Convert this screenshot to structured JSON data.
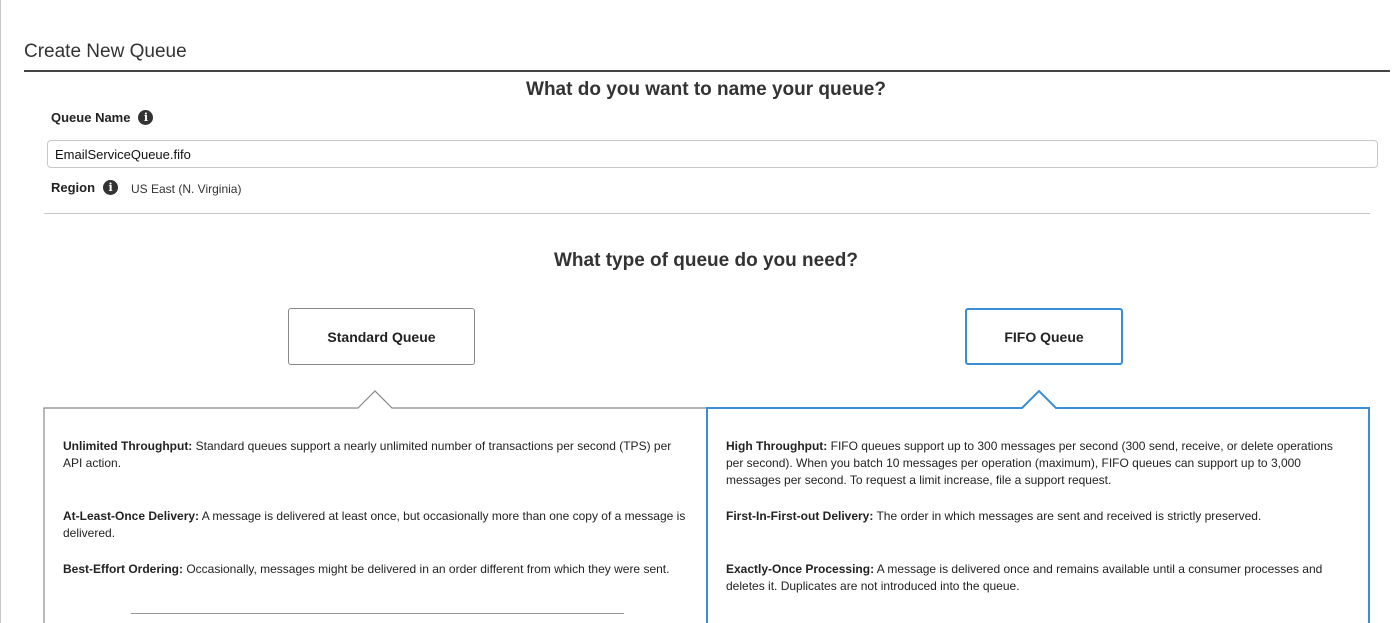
{
  "page": {
    "title": "Create New Queue"
  },
  "name_section": {
    "heading": "What do you want to name your queue?",
    "queue_name_label": "Queue Name",
    "queue_name_value": "EmailServiceQueue.fifo",
    "region_label": "Region",
    "region_value": "US East (N. Virginia)",
    "info_glyph": "i"
  },
  "type_section": {
    "heading": "What type of queue do you need?",
    "selected": "FIFO Queue",
    "accent_color": "#3a8ed6",
    "standard": {
      "button_label": "Standard Queue",
      "features": [
        {
          "title": "Unlimited Throughput:",
          "text": " Standard queues support a nearly unlimited number of transactions per second (TPS) per API action."
        },
        {
          "title": "At-Least-Once Delivery:",
          "text": " A message is delivered at least once, but occasionally more than one copy of a message is delivered."
        },
        {
          "title": "Best-Effort Ordering:",
          "text": " Occasionally, messages might be delivered in an order different from which they were sent."
        }
      ]
    },
    "fifo": {
      "button_label": "FIFO Queue",
      "features": [
        {
          "title": "High Throughput:",
          "text": " FIFO queues support up to 300 messages per second (300 send, receive, or delete operations per second). When you batch 10 messages per operation (maximum), FIFO queues can support up to 3,000 messages per second. To request a limit increase, file a support request."
        },
        {
          "title": "First-In-First-out Delivery:",
          "text": " The order in which messages are sent and received is strictly preserved."
        },
        {
          "title": "Exactly-Once Processing:",
          "text": " A message is delivered once and remains available until a consumer processes and deletes it. Duplicates are not introduced into the queue."
        }
      ]
    }
  }
}
